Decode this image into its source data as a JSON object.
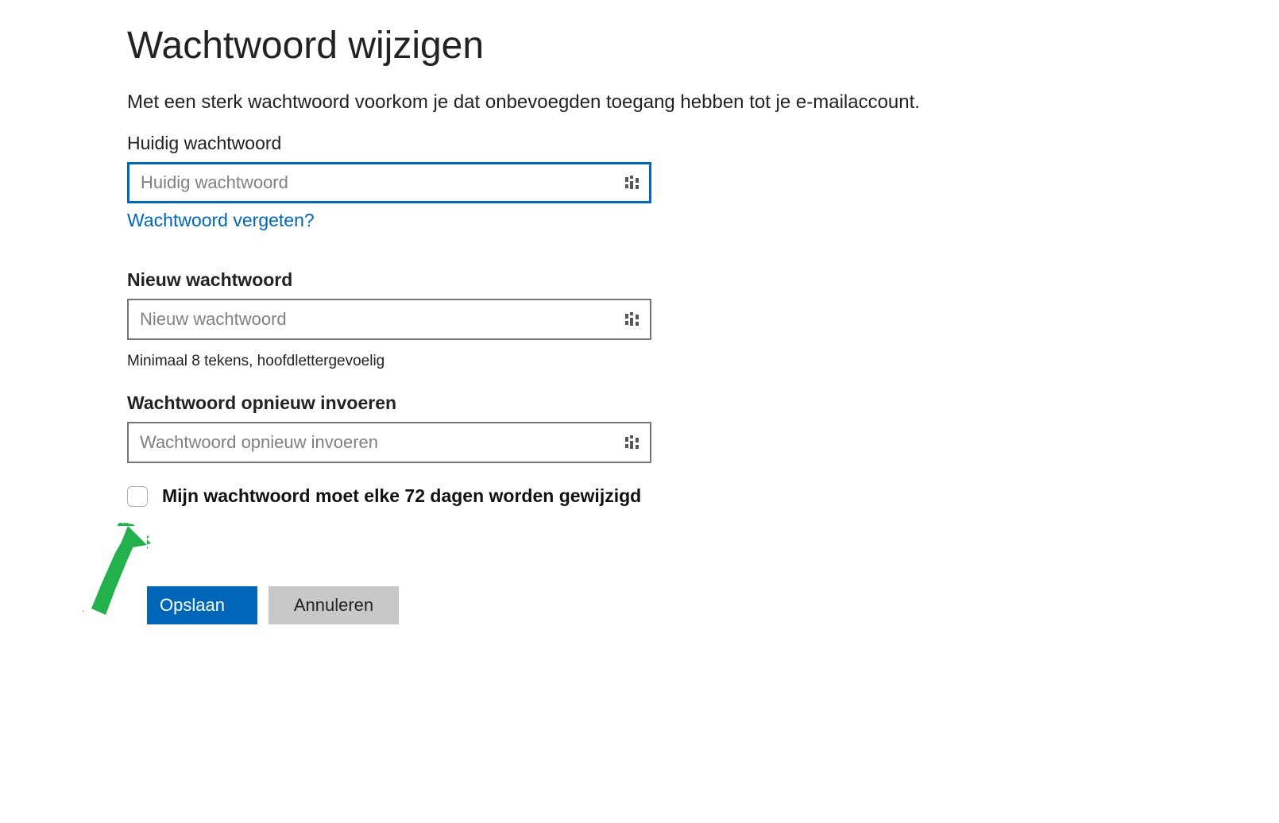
{
  "title": "Wachtwoord wijzigen",
  "description": "Met een sterk wachtwoord voorkom je dat onbevoegden toegang hebben tot je e-mailaccount.",
  "current_password": {
    "label": "Huidig wachtwoord",
    "placeholder": "Huidig wachtwoord"
  },
  "forgot_link": "Wachtwoord vergeten?",
  "new_password": {
    "label": "Nieuw wachtwoord",
    "placeholder": "Nieuw wachtwoord"
  },
  "hint": "Minimaal 8 tekens, hoofdlettergevoelig",
  "confirm_password": {
    "label": "Wachtwoord opnieuw invoeren",
    "placeholder": "Wachtwoord opnieuw invoeren"
  },
  "checkbox_label": "Mijn wachtwoord moet elke 72 dagen worden gewijzigd",
  "buttons": {
    "save": "Opslaan",
    "cancel": "Annuleren"
  }
}
